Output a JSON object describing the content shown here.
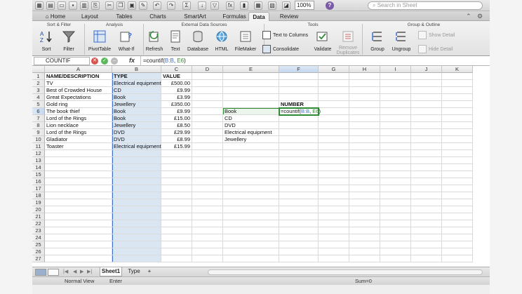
{
  "toolbar": {
    "zoom": "100%",
    "search_placeholder": "Search in Sheet",
    "help": "?"
  },
  "ribbon_tabs": [
    "Home",
    "Layout",
    "Tables",
    "Charts",
    "SmartArt",
    "Formulas",
    "Data",
    "Review"
  ],
  "active_tab": "Data",
  "ribbon_groups": {
    "sort_filter": "Sort & Filter",
    "analysis": "Analysis",
    "external": "External Data Sources",
    "tools": "Tools",
    "group_outline": "Group & Outline"
  },
  "ribbon_buttons": {
    "sort": "Sort",
    "filter": "Filter",
    "pivot_table": "PivotTable",
    "what_if": "What-If",
    "refresh": "Refresh",
    "text": "Text",
    "database": "Database",
    "html": "HTML",
    "filemaker": "FileMaker",
    "text_to_columns": "Text to Columns",
    "consolidate": "Consolidate",
    "validate": "Validate",
    "remove_duplicates_1": "Remove",
    "remove_duplicates_2": "Duplicates",
    "group": "Group",
    "ungroup": "Ungroup",
    "show_detail": "Show Detail",
    "hide_detail": "Hide Detail"
  },
  "formula_bar": {
    "name_box": "COUNTIF",
    "fx": "fx",
    "formula_prefix": "=countif(",
    "formula_ref1": "B:B",
    "formula_sep": ", ",
    "formula_ref2": "E6",
    "formula_suffix": ")"
  },
  "columns": [
    "A",
    "B",
    "C",
    "D",
    "E",
    "F",
    "G",
    "H",
    "I",
    "J",
    "K"
  ],
  "selected_column": "F",
  "selected_row": "6",
  "rows": [
    "1",
    "2",
    "3",
    "4",
    "5",
    "6",
    "7",
    "8",
    "9",
    "10",
    "11",
    "12",
    "13",
    "14",
    "15",
    "16",
    "17",
    "18",
    "19",
    "20",
    "21",
    "22",
    "23",
    "24",
    "25",
    "26",
    "27"
  ],
  "headers": {
    "a": "NAME/DESCRIPTION",
    "b": "TYPE",
    "c": "VALUE"
  },
  "data_rows": [
    {
      "name": "TV",
      "type": "Electrical equipment",
      "value": "£500.00"
    },
    {
      "name": "Best of Crowded House",
      "type": "CD",
      "value": "£9.99"
    },
    {
      "name": "Great Expectations",
      "type": "Book",
      "value": "£3.99"
    },
    {
      "name": "Gold ring",
      "type": "Jewellery",
      "value": "£350.00"
    },
    {
      "name": "The book thief",
      "type": "Book",
      "value": "£9.99"
    },
    {
      "name": "Lord of the Rings",
      "type": "Book",
      "value": "£15.00"
    },
    {
      "name": "Lion necklace",
      "type": "Jewellery",
      "value": "£8.50"
    },
    {
      "name": "Lord of the Rings",
      "type": "DVD",
      "value": "£29.99"
    },
    {
      "name": "Gladiator",
      "type": "DVD",
      "value": "£8.99"
    },
    {
      "name": "Toaster",
      "type": "Electrical equipment",
      "value": "£15.99"
    }
  ],
  "types_list": [
    "Book",
    "CD",
    "DVD",
    "Electrical equipment",
    "Jewellery"
  ],
  "number_header": "NUMBER",
  "sheets": [
    "Sheet1",
    "Type"
  ],
  "active_sheet": "Sheet1",
  "add_sheet": "+",
  "status": {
    "view": "Normal View",
    "mode": "Enter",
    "sum": "Sum=0"
  }
}
